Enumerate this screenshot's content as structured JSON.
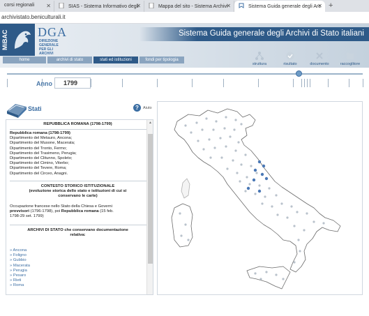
{
  "browser": {
    "tabs": [
      {
        "label": "corsi regionali",
        "active": false
      },
      {
        "label": "SIAS - Sistema Informativo degli",
        "active": false
      },
      {
        "label": "Mappa del sito - Sistema Archivi",
        "active": false
      },
      {
        "label": "Sistema Guida generale degli Arc",
        "active": true
      }
    ],
    "new_tab": "+",
    "url": "archivistato.beniculturali.it"
  },
  "header": {
    "logo_side_text": "MiBAC",
    "logo_big": "DGA",
    "logo_small_lines": [
      "DIREZIONE",
      "GENERALE",
      "PER GLI",
      "ARCHIVI"
    ],
    "site_title": "Sistema Guida generale degli Archivi di Stato italiani",
    "nav": [
      "home",
      "archivi di stato",
      "stati ed istituzioni",
      "fondi per tipologia"
    ],
    "nav_active": "stati ed istituzioni",
    "tools": [
      "struttura",
      "risultato",
      "documento",
      "raccoglitore"
    ]
  },
  "timeline": {
    "label": "Anno",
    "value": "1799",
    "slider_fraction": 0.82
  },
  "panel": {
    "title": "Stati",
    "help": "Aiuto",
    "republic_title": "REPUBBLICA ROMANA (1798-1799)",
    "republic_name": "Repubblica romana (1798-1799)",
    "departments": [
      "Dipartimento del Metauro, Ancona;",
      "Dipartimento del Musone, Macerata;",
      "Dipartimento del Tronto, Fermo;",
      "Dipartimento del Trasimeno, Perugia;",
      "Dipartimento del Clitunno, Spoleto;",
      "Dipartimento del Cimino, Viterbo;",
      "Dipartimento del Tevere, Roma;",
      "Dipartimento del Circeo, Anagni."
    ],
    "context_title": "CONTESTO STORICO ISTITUZIONALE",
    "context_subtitle": "(evoluzione storica dello stato e istituzioni di cui si conservano le carte)",
    "context_text_1": "Occupazione francese nello Stato della Chiesa e Governi",
    "context_text_2_bold": "provvisori",
    "context_text_2_rest": " (1796-1798), poi ",
    "context_text_2_bold2": "Repubblica romana",
    "context_text_2_end": " (15 feb.",
    "context_text_3": "1798-29 set. 1799)",
    "archives_title": "ARCHIVI DI STATO che conservano documentazione relativa:",
    "archives": [
      "Ancona",
      "Foligno",
      "Gubbio",
      "Macerata",
      "Perugia",
      "Pesaro",
      "Rieti",
      "Roma"
    ]
  },
  "colors": {
    "brand_blue": "#2e5a88",
    "accent_blue": "#3c6ea3",
    "map_dot": "#b9c2cc",
    "map_dot_active": "#4a78b5"
  }
}
